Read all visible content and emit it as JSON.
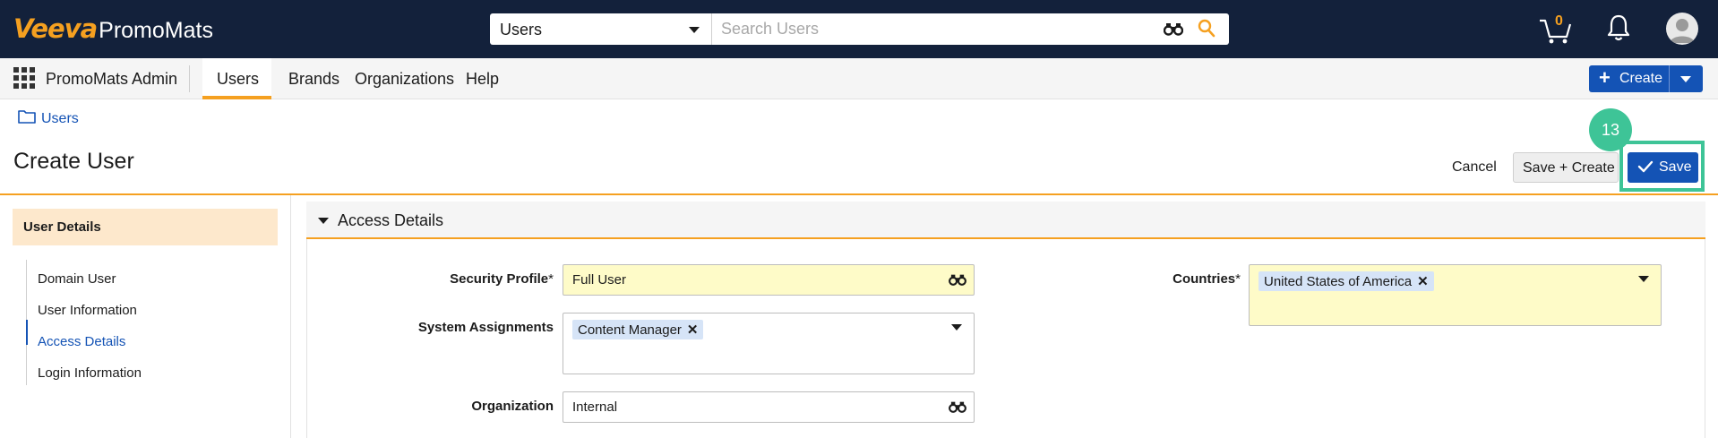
{
  "app": {
    "logo_brand": "Veeva",
    "logo_product": "PromoMats",
    "accent_color": "#f5a020",
    "primary_color": "#1453b5",
    "header_bg": "#13213b"
  },
  "topbar": {
    "search_scope": "Users",
    "search_placeholder": "Search Users",
    "cart_count": "0",
    "icons": [
      "binoculars-icon",
      "search-icon",
      "cart-icon",
      "bell-icon",
      "user-avatar-icon"
    ]
  },
  "nav": {
    "app_name": "PromoMats Admin",
    "items": [
      "Users",
      "Brands",
      "Organizations",
      "Help"
    ],
    "active": "Users",
    "create_label": "Create"
  },
  "breadcrumb": {
    "label": "Users"
  },
  "page": {
    "title": "Create User",
    "cancel_label": "Cancel",
    "save_create_label": "Save + Create",
    "save_label": "Save",
    "step_badge": "13"
  },
  "sidebar": {
    "heading": "User Details",
    "items": [
      {
        "label": "Domain User"
      },
      {
        "label": "User Information"
      },
      {
        "label": "Access Details"
      },
      {
        "label": "Login Information"
      }
    ],
    "active_item": "Access Details"
  },
  "section": {
    "title": "Access Details",
    "fields": {
      "security_profile": {
        "label": "Security Profile",
        "required": "*",
        "value": "Full User"
      },
      "system_assignments": {
        "label": "System Assignments",
        "chip": "Content Manager"
      },
      "organization": {
        "label": "Organization",
        "value": "Internal"
      },
      "countries": {
        "label": "Countries",
        "required": "*",
        "chip": "United States of America"
      }
    }
  }
}
